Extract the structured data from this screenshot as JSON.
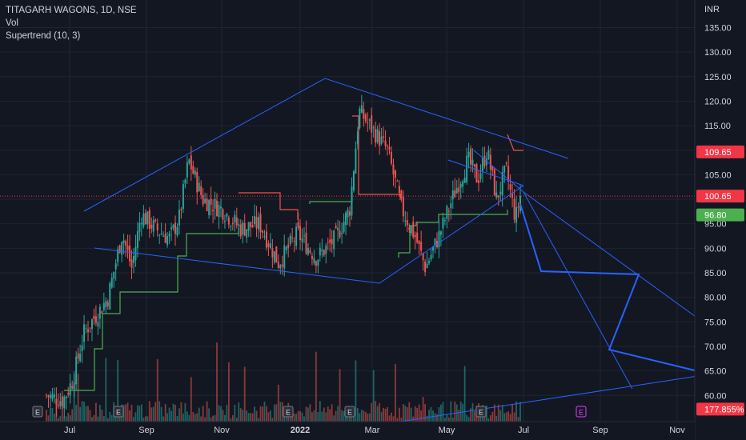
{
  "legend": {
    "title": "TITAGARH WAGONS, 1D, NSE",
    "vol": "Vol",
    "indicator": "Supertrend (10, 3)"
  },
  "currency": "INR",
  "colors": {
    "background": "#131722",
    "grid": "#1f2433",
    "up": "#26a69a",
    "down": "#ef5350",
    "supertrend_up": "#4caf50",
    "supertrend_down": "#ef5350",
    "trendline": "#2962ff",
    "text": "#d1d4dc"
  },
  "chart_data": {
    "type": "candlestick",
    "y_axis": {
      "ticks": [
        "135.00",
        "130.00",
        "125.00",
        "120.00",
        "115.00",
        "110.00",
        "105.00",
        "100.00",
        "95.00",
        "90.00",
        "85.00",
        "80.00",
        "75.00",
        "70.00",
        "65.00",
        "60.00"
      ],
      "range": [
        56.5,
        137.5
      ]
    },
    "x_axis": {
      "ticks": [
        "Jul",
        "Sep",
        "Nov",
        "2022",
        "Mar",
        "May",
        "Jul",
        "Sep",
        "Nov"
      ]
    },
    "price_tags": [
      {
        "label": "109.65",
        "value": 109.65,
        "color": "#f23645"
      },
      {
        "label": "100.65",
        "value": 100.65,
        "color": "#f23645"
      },
      {
        "label": "96.80",
        "value": 96.8,
        "color": "#4caf50"
      },
      {
        "label": "177.855%",
        "value": 57.2,
        "color": "#f23645"
      }
    ],
    "current_price_line": 100.65,
    "earnings_markers": 7,
    "candles_close_path": [
      {
        "t": 0,
        "v": 60
      },
      {
        "t": 0.035,
        "v": 59
      },
      {
        "t": 0.055,
        "v": 63
      },
      {
        "t": 0.08,
        "v": 73
      },
      {
        "t": 0.11,
        "v": 77
      },
      {
        "t": 0.13,
        "v": 80
      },
      {
        "t": 0.16,
        "v": 93
      },
      {
        "t": 0.18,
        "v": 86
      },
      {
        "t": 0.2,
        "v": 97
      },
      {
        "t": 0.23,
        "v": 94
      },
      {
        "t": 0.26,
        "v": 92
      },
      {
        "t": 0.28,
        "v": 96
      },
      {
        "t": 0.3,
        "v": 108
      },
      {
        "t": 0.33,
        "v": 100
      },
      {
        "t": 0.37,
        "v": 98
      },
      {
        "t": 0.41,
        "v": 94
      },
      {
        "t": 0.45,
        "v": 95
      },
      {
        "t": 0.49,
        "v": 87
      },
      {
        "t": 0.53,
        "v": 93
      },
      {
        "t": 0.57,
        "v": 88
      },
      {
        "t": 0.61,
        "v": 92
      },
      {
        "t": 0.64,
        "v": 98
      },
      {
        "t": 0.66,
        "v": 118
      },
      {
        "t": 0.69,
        "v": 114
      },
      {
        "t": 0.72,
        "v": 110
      },
      {
        "t": 0.75,
        "v": 98
      },
      {
        "t": 0.78,
        "v": 92
      },
      {
        "t": 0.8,
        "v": 86
      },
      {
        "t": 0.83,
        "v": 93
      },
      {
        "t": 0.86,
        "v": 101
      },
      {
        "t": 0.89,
        "v": 108
      },
      {
        "t": 0.91,
        "v": 104
      },
      {
        "t": 0.93,
        "v": 110
      },
      {
        "t": 0.95,
        "v": 100
      },
      {
        "t": 0.97,
        "v": 106
      },
      {
        "t": 0.99,
        "v": 96
      },
      {
        "t": 1,
        "v": 100.65
      }
    ]
  }
}
